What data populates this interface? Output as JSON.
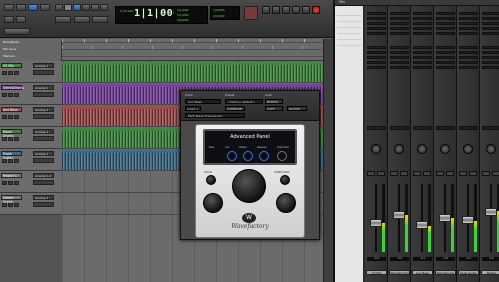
{
  "toolbar": {
    "main_counter": "1|1|000",
    "sub_counter": "0:00.000",
    "selection": [
      "1|1|000",
      "1|1|000",
      "0|0|000"
    ],
    "grid": "1|0|000",
    "nudge": "0|1|000"
  },
  "ruler": {
    "labels": [
      "Bars|Beats",
      "Min:Secs",
      "Markers"
    ]
  },
  "tracks": [
    {
      "name": "V2 Mix",
      "color": "#3b8a3b",
      "io": "Analog 1"
    },
    {
      "name": "StereoDrums",
      "color": "#7a3fa3",
      "io": "Analog 1"
    },
    {
      "name": "Aux Bass",
      "color": "#a3494b",
      "io": "Analog 1"
    },
    {
      "name": "Room Drums",
      "color": "#3b8a3b",
      "io": "Analog 1"
    },
    {
      "name": "Pumk Guitar",
      "color": "#3b6a8a",
      "io": "Analog 1"
    },
    {
      "name": "Master 1",
      "color": "#7a7a7a",
      "io": "Analog 1-2"
    },
    {
      "name": "Comm Scene",
      "color": "#7a7a7a",
      "io": "Analog 1"
    }
  ],
  "plugin": {
    "track_label": "Track",
    "preset_label": "Preset",
    "auto_label": "Auto",
    "track_value": "Aux Bass",
    "preset_value": "<factory default>",
    "compare": "COMPARE",
    "safe": "SAFE",
    "bypass": "BYPASS",
    "native": "NATIVE",
    "insert": "Insert 1",
    "plugin_select": "MV2 Wave Transparent",
    "lcd_title": "Advanced Panel",
    "lcd_controls": [
      "Bias",
      "L-R",
      "Attack",
      "Release",
      "Sidechain"
    ],
    "hold_label": "HOLD",
    "sidechain_label": "SIDECHAIN",
    "brand": "Wavefactory",
    "logo": "W"
  },
  "mix": {
    "title": "Mix",
    "strips": [
      {
        "name": "V2 Mix",
        "volume": "-0.4"
      },
      {
        "name": "StereoDrums",
        "volume": "-3.5"
      },
      {
        "name": "Aux Bass",
        "volume": "-4.1"
      },
      {
        "name": "RoomDrums",
        "volume": "-5.0"
      },
      {
        "name": "Punk Guitar",
        "volume": "-3.3"
      },
      {
        "name": "Master",
        "volume": "0.0"
      }
    ],
    "meters": [
      0.42,
      0.55,
      0.38,
      0.5,
      0.46,
      0.6
    ]
  }
}
